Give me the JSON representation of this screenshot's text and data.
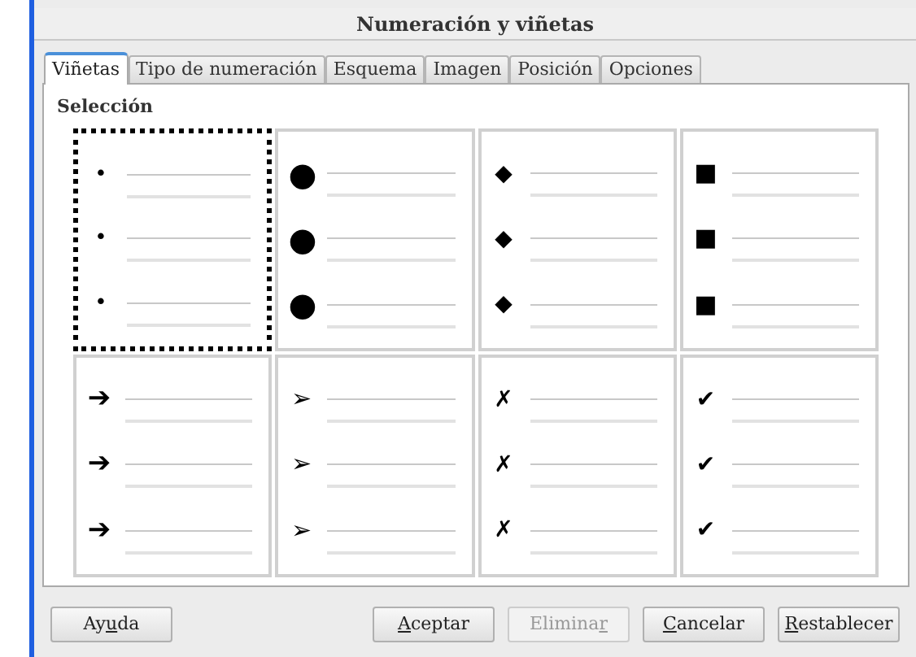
{
  "window": {
    "title": "Numeración y viñetas"
  },
  "tabs": [
    {
      "label": "Viñetas",
      "selected": true
    },
    {
      "label": "Tipo de numeración",
      "selected": false
    },
    {
      "label": "Esquema",
      "selected": false
    },
    {
      "label": "Imagen",
      "selected": false
    },
    {
      "label": "Posición",
      "selected": false
    },
    {
      "label": "Opciones",
      "selected": false
    }
  ],
  "section": {
    "title": "Selección"
  },
  "bullets": [
    {
      "symbol": "•",
      "selected": true
    },
    {
      "symbol": "●",
      "selected": false
    },
    {
      "symbol": "◆",
      "selected": false
    },
    {
      "symbol": "■",
      "selected": false
    },
    {
      "symbol": "➔",
      "selected": false
    },
    {
      "symbol": "➢",
      "selected": false
    },
    {
      "symbol": "✗",
      "selected": false
    },
    {
      "symbol": "✔",
      "selected": false
    }
  ],
  "buttons": [
    {
      "before": "Ay",
      "key": "u",
      "after": "da",
      "disabled": false
    },
    {
      "key": "A",
      "after": "ceptar",
      "disabled": false
    },
    {
      "before": "Elimina",
      "key": "r",
      "disabled": true
    },
    {
      "key": "C",
      "after": "ancelar",
      "disabled": false
    },
    {
      "key": "R",
      "after": "establecer",
      "disabled": false
    }
  ]
}
